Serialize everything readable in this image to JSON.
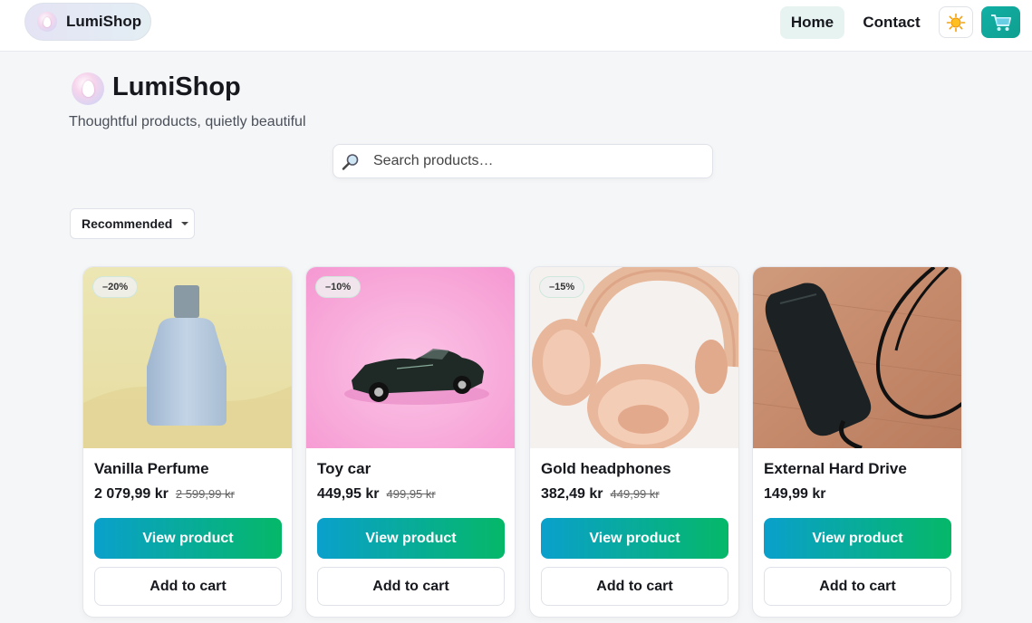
{
  "header": {
    "brand": "LumiShop",
    "nav": [
      {
        "label": "Home",
        "active": true
      },
      {
        "label": "Contact",
        "active": false
      }
    ],
    "theme_icon": "sun-icon",
    "cart_icon": "cart-icon",
    "accent_color": "#11b0a6"
  },
  "hero": {
    "title": "LumiShop",
    "subtitle": "Thoughtful products, quietly beautiful"
  },
  "search": {
    "placeholder": "Search products…",
    "value": "",
    "icon": "magnifier-icon"
  },
  "sort": {
    "selected": "Recommended"
  },
  "products": [
    {
      "name": "Vanilla Perfume",
      "price": "2 079,99 kr",
      "old_price": "2 599,99 kr",
      "discount": "–20%",
      "image": "perfume-bottle",
      "view_label": "View product",
      "cart_label": "Add to cart"
    },
    {
      "name": "Toy car",
      "price": "449,95 kr",
      "old_price": "499,95 kr",
      "discount": "–10%",
      "image": "toy-car",
      "view_label": "View product",
      "cart_label": "Add to cart"
    },
    {
      "name": "Gold headphones",
      "price": "382,49 kr",
      "old_price": "449,99 kr",
      "discount": "–15%",
      "image": "headphones",
      "view_label": "View product",
      "cart_label": "Add to cart"
    },
    {
      "name": "External Hard Drive",
      "price": "149,99 kr",
      "old_price": "",
      "discount": "",
      "image": "hard-drive",
      "view_label": "View product",
      "cart_label": "Add to cart"
    }
  ]
}
